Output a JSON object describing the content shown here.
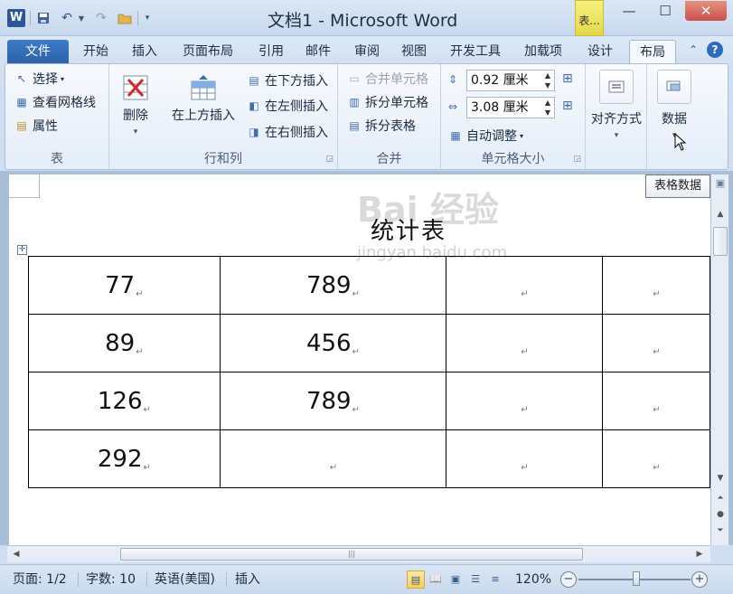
{
  "titlebar": {
    "app_letter": "W",
    "title": "文档1 - Microsoft Word",
    "context_tab_label": "表...",
    "minimize": "—",
    "maximize": "☐",
    "close": "✕"
  },
  "tabs": [
    "文件",
    "开始",
    "插入",
    "页面布局",
    "引用",
    "邮件",
    "审阅",
    "视图",
    "开发工具",
    "加载项",
    "设计",
    "布局"
  ],
  "active_tab": "布局",
  "ribbon": {
    "table_group": {
      "label": "表",
      "select": "选择",
      "gridlines": "查看网格线",
      "properties": "属性"
    },
    "rows_cols_group": {
      "label": "行和列",
      "delete": "删除",
      "insert_above": "在上方插入",
      "insert_below": "在下方插入",
      "insert_left": "在左侧插入",
      "insert_right": "在右侧插入"
    },
    "merge_group": {
      "label": "合并",
      "merge_cells": "合并单元格",
      "split_cells": "拆分单元格",
      "split_table": "拆分表格"
    },
    "cell_size_group": {
      "label": "单元格大小",
      "height_value": "0.92 厘米",
      "width_value": "3.08 厘米",
      "autofit": "自动调整"
    },
    "alignment": "对齐方式",
    "data": "数据"
  },
  "tooltip": "表格数据",
  "document": {
    "title": "统计表",
    "watermark": "Bai 经验",
    "watermark_sub": "jingyan.baidu.com",
    "rows": [
      [
        "77",
        "789",
        "",
        ""
      ],
      [
        "89",
        "456",
        "",
        ""
      ],
      [
        "126",
        "789",
        "",
        ""
      ],
      [
        "292",
        "",
        "",
        ""
      ]
    ]
  },
  "statusbar": {
    "page": "页面: 1/2",
    "words": "字数: 10",
    "language": "英语(美国)",
    "mode": "插入",
    "zoom": "120%",
    "zoom_minus": "−",
    "zoom_plus": "+"
  }
}
